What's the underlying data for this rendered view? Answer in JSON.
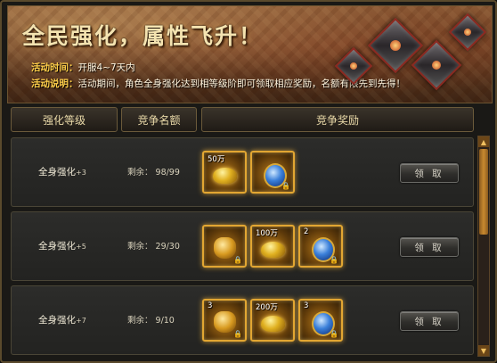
{
  "banner": {
    "title": "全民强化，属性飞升！",
    "time_label": "活动时间：",
    "time_value": "开服4~7天内",
    "desc_label": "活动说明：",
    "desc_value": "活动期间，角色全身强化达到相等级阶即可领取相应奖励，名额有限先到先得！"
  },
  "headers": {
    "level": "强化等级",
    "quota": "竞争名额",
    "reward": "竞争奖励"
  },
  "rows": [
    {
      "level": "全身强化",
      "level_suffix": "+3",
      "remaining": "剩余： 98/99",
      "claim_label": "领 取",
      "items": [
        {
          "icon": "gold-ingot-icon",
          "qty": "50万",
          "locked": false
        },
        {
          "icon": "blue-gem-icon",
          "qty": "",
          "locked": true
        }
      ]
    },
    {
      "level": "全身强化",
      "level_suffix": "+5",
      "remaining": "剩余： 29/30",
      "claim_label": "领 取",
      "items": [
        {
          "icon": "gold-bag-icon",
          "qty": "",
          "locked": true
        },
        {
          "icon": "gold-ingot-icon",
          "qty": "100万",
          "locked": false
        },
        {
          "icon": "blue-gem-icon",
          "qty": "2",
          "locked": true
        }
      ]
    },
    {
      "level": "全身强化",
      "level_suffix": "+7",
      "remaining": "剩余： 9/10",
      "claim_label": "领 取",
      "items": [
        {
          "icon": "gold-bag-icon",
          "qty": "3",
          "locked": true
        },
        {
          "icon": "gold-ingot-icon",
          "qty": "200万",
          "locked": false
        },
        {
          "icon": "blue-gem-icon",
          "qty": "3",
          "locked": true
        }
      ]
    }
  ],
  "lock_glyph": "🔒",
  "scroll_up_glyph": "▲",
  "scroll_down_glyph": "▼"
}
